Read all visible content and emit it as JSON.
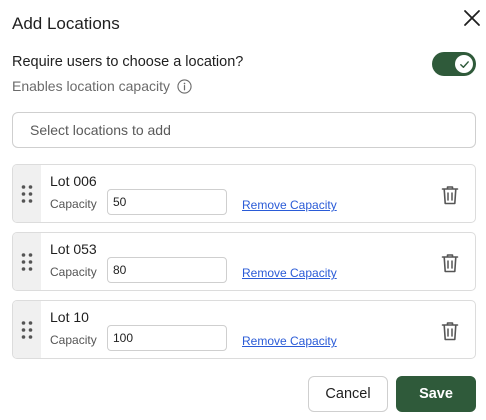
{
  "dialog": {
    "title": "Add Locations",
    "close_icon": "close-icon"
  },
  "requirement": {
    "label": "Require users to choose a location?",
    "sublabel": "Enables location capacity",
    "toggle_on": true
  },
  "select": {
    "placeholder": "Select locations to add"
  },
  "locations": [
    {
      "name": "Lot 006",
      "capacity_label": "Capacity",
      "capacity": "50",
      "remove_label": "Remove Capacity"
    },
    {
      "name": "Lot 053",
      "capacity_label": "Capacity",
      "capacity": "80",
      "remove_label": "Remove Capacity"
    },
    {
      "name": "Lot 10",
      "capacity_label": "Capacity",
      "capacity": "100",
      "remove_label": "Remove Capacity"
    }
  ],
  "actions": {
    "cancel_label": "Cancel",
    "save_label": "Save"
  },
  "colors": {
    "accent": "#2f5a3a",
    "link": "#2a5bd7"
  }
}
